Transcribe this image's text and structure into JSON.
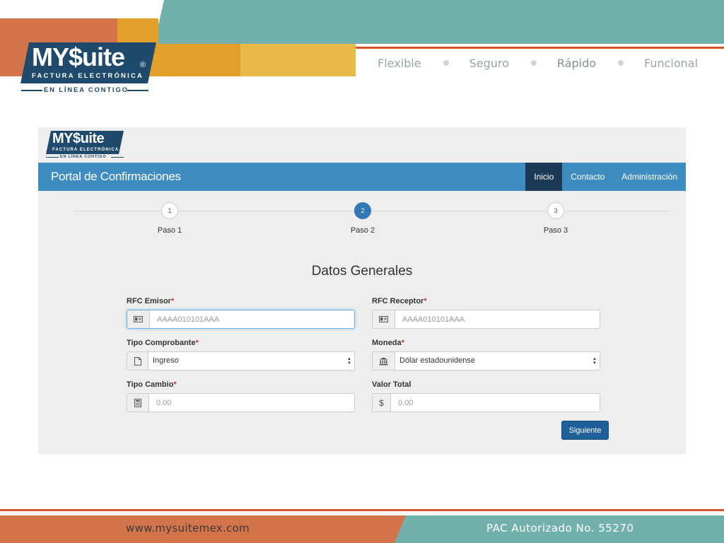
{
  "banner": {
    "logo_main": "MY$uite",
    "logo_reg": "®",
    "logo_sub": "FACTURA ELECTRÓNICA",
    "logo_tagline": "EN LÍNEA CONTIGO",
    "values": [
      "Flexible",
      "Seguro",
      "Rápido",
      "Funcional"
    ]
  },
  "portal": {
    "logo_main": "MY$uite",
    "logo_sub": "FACTURA ELECTRÓNICA",
    "logo_tagline": "EN LÍNEA CONTIGO",
    "brand": "Portal de Confirmaciones",
    "nav": [
      {
        "label": "Inicio",
        "active": true
      },
      {
        "label": "Contacto",
        "active": false
      },
      {
        "label": "Administración",
        "active": false
      }
    ],
    "steps": [
      {
        "number": "1",
        "label": "Paso 1",
        "active": false
      },
      {
        "number": "2",
        "label": "Paso 2",
        "active": true
      },
      {
        "number": "3",
        "label": "Paso 3",
        "active": false
      }
    ],
    "form_title": "Datos Generales",
    "required_mark": "*",
    "fields": {
      "rfc_emisor": {
        "label": "RFC Emisor",
        "placeholder": "AAAA010101AAA",
        "icon": "id-card-icon"
      },
      "rfc_receptor": {
        "label": "RFC Receptor",
        "placeholder": "AAAA010101AAA",
        "icon": "id-card-icon"
      },
      "tipo_comprobante": {
        "label": "Tipo Comprobante",
        "value": "Ingreso",
        "icon": "document-icon"
      },
      "moneda": {
        "label": "Moneda",
        "value": "Dólar estadounidense",
        "icon": "bank-icon"
      },
      "tipo_cambio": {
        "label": "Tipo Cambio",
        "placeholder": "0.00",
        "icon": "calculator-icon"
      },
      "valor_total": {
        "label": "Valor Total",
        "placeholder": "0.00",
        "icon": "dollar-icon",
        "addon_text": "$"
      }
    },
    "next_button": "Siguiente"
  },
  "footer": {
    "url": "www.mysuitemex.com",
    "pac": "PAC Autorizado No. 55270"
  },
  "colors": {
    "navbar": "#3e8cc0",
    "nav_active": "#1b3a55",
    "step_active": "#3377b5",
    "button": "#1f5f9a",
    "banner_teal": "#72b1ab",
    "banner_orange": "#d4744a",
    "banner_gold": "#e3a02a",
    "accent_red": "#d6532f",
    "logo_navy": "#1f4a6b"
  }
}
